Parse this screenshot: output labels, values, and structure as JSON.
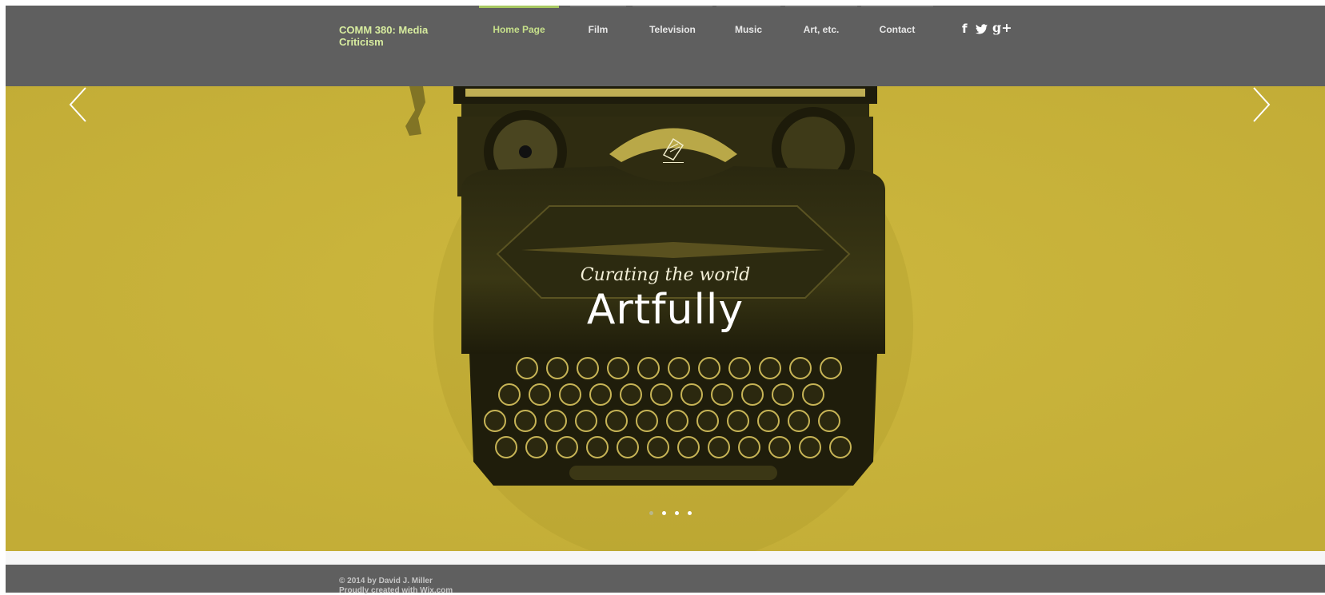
{
  "header": {
    "site_title": "COMM 380:  Media\nCriticism",
    "nav": [
      {
        "label": "Home Page",
        "active": true
      },
      {
        "label": "Film",
        "active": false
      },
      {
        "label": "Television",
        "active": false
      },
      {
        "label": "Music",
        "active": false
      },
      {
        "label": "Art, etc.",
        "active": false
      },
      {
        "label": "Contact",
        "active": false
      }
    ],
    "social": {
      "facebook": "f",
      "twitter": "🐦",
      "googleplus": "g+"
    }
  },
  "hero": {
    "tagline": "Curating the world",
    "headline": "Artfully",
    "slide_count": 4,
    "active_slide": 1
  },
  "footer": {
    "copyright": "© 2014 by David J. Miller",
    "credit": "Proudly created with Wix.com"
  },
  "colors": {
    "header_bg": "#5f5f5f",
    "hero_bg": "#c8b23a",
    "accent": "#a8c862"
  }
}
